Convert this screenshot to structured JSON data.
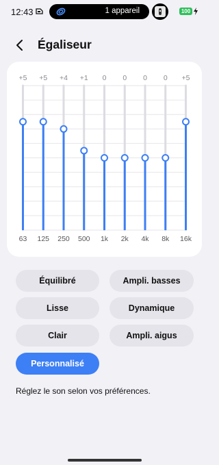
{
  "status": {
    "time": "12:43",
    "devices_label": "1 appareil",
    "battery": "100"
  },
  "header": {
    "title": "Égaliseur"
  },
  "equalizer": {
    "bands": [
      {
        "freq": "63",
        "gain_label": "+5",
        "gain": 5
      },
      {
        "freq": "125",
        "gain_label": "+5",
        "gain": 5
      },
      {
        "freq": "250",
        "gain_label": "+4",
        "gain": 4
      },
      {
        "freq": "500",
        "gain_label": "+1",
        "gain": 1
      },
      {
        "freq": "1k",
        "gain_label": "0",
        "gain": 0
      },
      {
        "freq": "2k",
        "gain_label": "0",
        "gain": 0
      },
      {
        "freq": "4k",
        "gain_label": "0",
        "gain": 0
      },
      {
        "freq": "8k",
        "gain_label": "0",
        "gain": 0
      },
      {
        "freq": "16k",
        "gain_label": "+5",
        "gain": 5
      }
    ],
    "gain_range": [
      -10,
      10
    ],
    "accent_color": "#3d7ff5"
  },
  "presets": {
    "balanced": "Équilibré",
    "bass_boost": "Ampli. basses",
    "smooth": "Lisse",
    "dynamic": "Dynamique",
    "clear": "Clair",
    "treble_boost": "Ampli. aigus",
    "custom": "Personnalisé",
    "selected": "Personnalisé"
  },
  "hint": "Réglez le son selon vos préférences."
}
